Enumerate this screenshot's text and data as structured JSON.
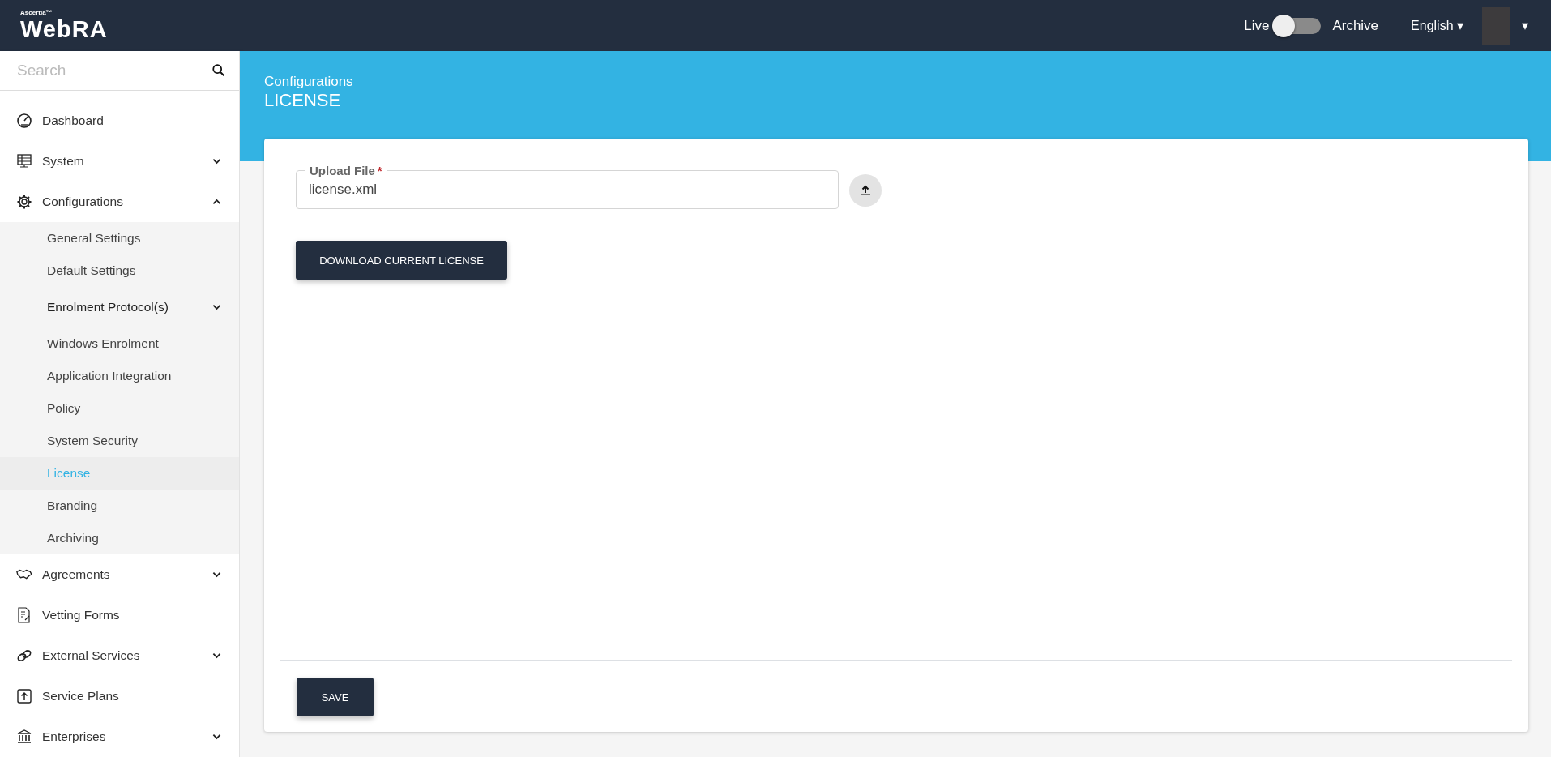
{
  "header": {
    "logo_small": "Ascertia™",
    "logo": "WebRA",
    "mode_left": "Live",
    "mode_right": "Archive",
    "archive_on": false,
    "language": "English ▾",
    "user_caret": "▾"
  },
  "sidebar": {
    "search_placeholder": "Search",
    "items": [
      {
        "kind": "link",
        "label": "Dashboard"
      },
      {
        "kind": "menu",
        "label": "System",
        "expanded": false
      },
      {
        "kind": "menu",
        "label": "Configurations",
        "expanded": true,
        "children": [
          {
            "kind": "sub",
            "label": "General Settings",
            "selected": false
          },
          {
            "kind": "sub",
            "label": "Default Settings",
            "selected": false
          },
          {
            "kind": "group",
            "label": "Enrolment Protocol(s)",
            "selected": false,
            "expanded": false
          },
          {
            "kind": "sub",
            "label": "Windows Enrolment",
            "selected": false
          },
          {
            "kind": "sub",
            "label": "Application Integration",
            "selected": false
          },
          {
            "kind": "sub",
            "label": "Policy",
            "selected": false
          },
          {
            "kind": "sub",
            "label": "System Security",
            "selected": false
          },
          {
            "kind": "sub",
            "label": "License",
            "selected": true
          },
          {
            "kind": "sub",
            "label": "Branding",
            "selected": false
          },
          {
            "kind": "sub",
            "label": "Archiving",
            "selected": false
          }
        ]
      },
      {
        "kind": "menu",
        "label": "Agreements",
        "expanded": false
      },
      {
        "kind": "link",
        "label": "Vetting Forms"
      },
      {
        "kind": "menu",
        "label": "External Services",
        "expanded": false
      },
      {
        "kind": "link",
        "label": "Service Plans"
      },
      {
        "kind": "menu",
        "label": "Enterprises",
        "expanded": false
      }
    ]
  },
  "page": {
    "breadcrumb": "Configurations",
    "title": "LICENSE"
  },
  "form": {
    "upload_label": "Upload File",
    "required_mark": "*",
    "upload_value": "license.xml",
    "download_button": "DOWNLOAD CURRENT LICENSE",
    "save_button": "SAVE"
  }
}
